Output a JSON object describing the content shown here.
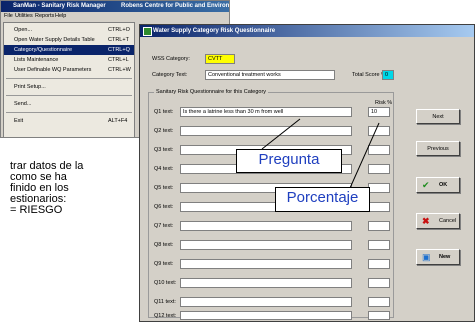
{
  "back_window": {
    "title_left": "SanMan - Sanitary Risk Manager",
    "title_right": "Robens Centre for Public and Environmental Health",
    "menubar": [
      "File",
      "Utilities",
      "Reports",
      "Help"
    ],
    "menu_items": [
      {
        "label": "Open...",
        "shortcut": "CTRL+O"
      },
      {
        "label": "Open Water Supply Details Table",
        "shortcut": "CTRL+T"
      },
      {
        "label": "Category/Questionnaire",
        "shortcut": "CTRL+Q",
        "selected": true
      },
      {
        "label": "Lists Maintenance",
        "shortcut": "CTRL+L"
      },
      {
        "label": "User Definable WQ Parameters",
        "shortcut": "CTRL+W"
      },
      {
        "label": "Print Setup...",
        "shortcut": ""
      },
      {
        "label": "Send...",
        "shortcut": ""
      },
      {
        "label": "Exit",
        "shortcut": "ALT+F4"
      }
    ]
  },
  "caption": {
    "lines": [
      "trar datos de la",
      "como se ha",
      "finido en los",
      "estionarios:",
      "= RIESGO"
    ]
  },
  "front_window": {
    "title": "Water Supply Category Risk Questionnaire",
    "wss_category_label": "WSS Category:",
    "wss_category_value": "CVTT",
    "category_text_label": "Category Text:",
    "category_text_value": "Conventional treatment works",
    "total_score_label": "Total Score %",
    "total_score_value": "0",
    "group_label": "Sanitary Risk Questionnaire for this Category",
    "risk_header": "Risk %",
    "questions": [
      {
        "label": "Q1 text:",
        "text": "Is there a latrine less than 30 m from well",
        "risk": "10"
      },
      {
        "label": "Q2 text:",
        "text": "",
        "risk": ""
      },
      {
        "label": "Q3 text:",
        "text": "",
        "risk": ""
      },
      {
        "label": "Q4 text:",
        "text": "",
        "risk": ""
      },
      {
        "label": "Q5 text:",
        "text": "",
        "risk": ""
      },
      {
        "label": "Q6 text:",
        "text": "",
        "risk": ""
      },
      {
        "label": "Q7 text:",
        "text": "",
        "risk": ""
      },
      {
        "label": "Q8 text:",
        "text": "",
        "risk": ""
      },
      {
        "label": "Q9 text:",
        "text": "",
        "risk": ""
      },
      {
        "label": "Q10 text:",
        "text": "",
        "risk": ""
      },
      {
        "label": "Q11 text:",
        "text": "",
        "risk": ""
      },
      {
        "label": "Q12 text:",
        "text": "",
        "risk": ""
      }
    ],
    "buttons": {
      "next": "Next",
      "previous": "Previous",
      "ok": "OK",
      "cancel": "Cancel",
      "new": "New"
    },
    "button_icons": {
      "ok": "checkmark-icon",
      "cancel": "x-icon",
      "new": "document-icon"
    },
    "colors": {
      "wss_highlight": "#ffff00",
      "score_highlight": "#00d8e8",
      "title_bar": "#0a246a"
    }
  },
  "annotations": {
    "pregunta": "Pregunta",
    "porcentaje": "Porcentaje"
  }
}
